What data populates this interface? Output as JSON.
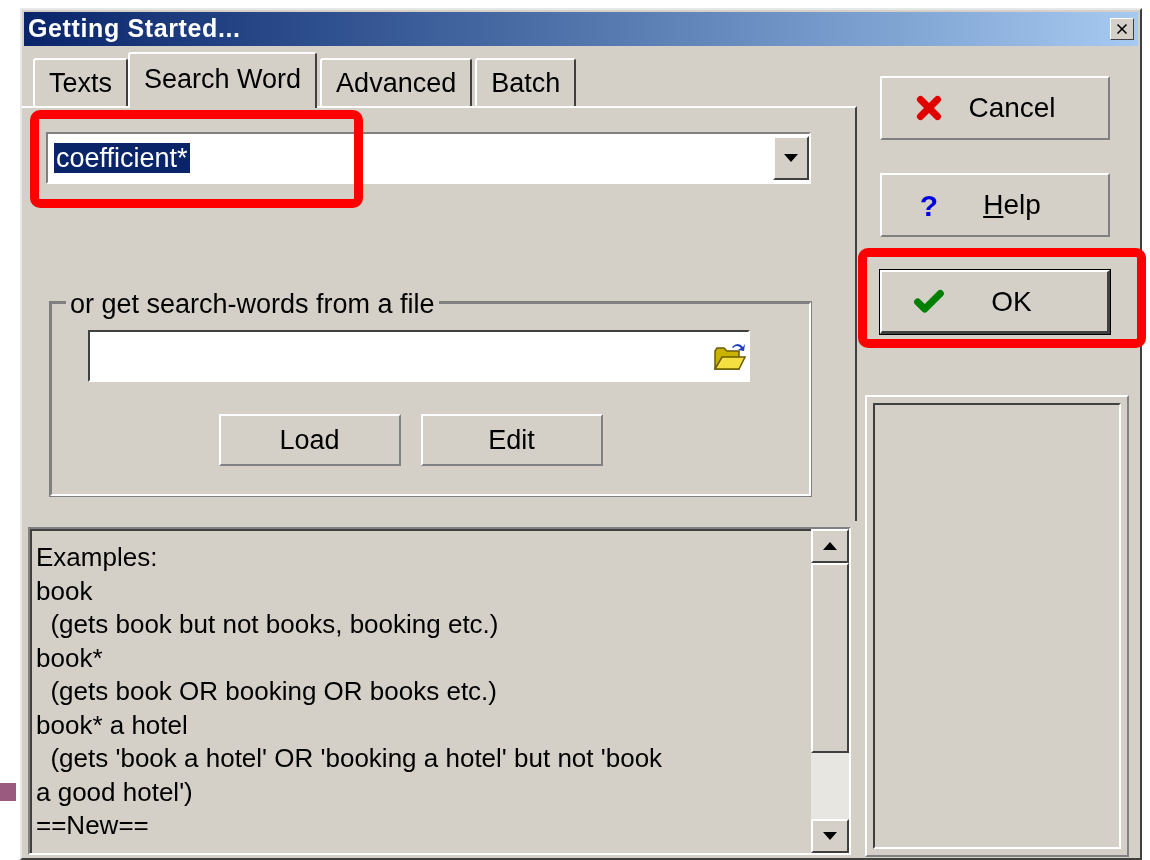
{
  "window": {
    "title": "Getting Started..."
  },
  "tabs": [
    {
      "label": "Texts",
      "selected": false
    },
    {
      "label": "Search Word",
      "selected": true
    },
    {
      "label": "Advanced",
      "selected": false
    },
    {
      "label": "Batch",
      "selected": false
    }
  ],
  "search_field": {
    "value": "coefficient*",
    "text_selected": true,
    "highlighted": true
  },
  "file_group": {
    "title": "or get search-words from a file",
    "buttons": [
      "Load",
      "Edit"
    ]
  },
  "examples": [
    "Examples:",
    "book",
    "  (gets book but not books, booking etc.)",
    "book*",
    "  (gets book OR booking OR books etc.)",
    "book* a hotel",
    "  (gets 'book a hotel' OR 'booking a hotel' but not 'book",
    "a good hotel')",
    "==New=="
  ],
  "buttons": [
    {
      "kind": "cancel",
      "label": "Cancel",
      "underline_first": false,
      "highlighted": false,
      "focused": false
    },
    {
      "kind": "help",
      "label": "Help",
      "icon": "?",
      "underline_first": true,
      "highlighted": false,
      "focused": false
    },
    {
      "kind": "ok",
      "label": "OK",
      "underline_first": false,
      "highlighted": true,
      "focused": true
    }
  ]
}
